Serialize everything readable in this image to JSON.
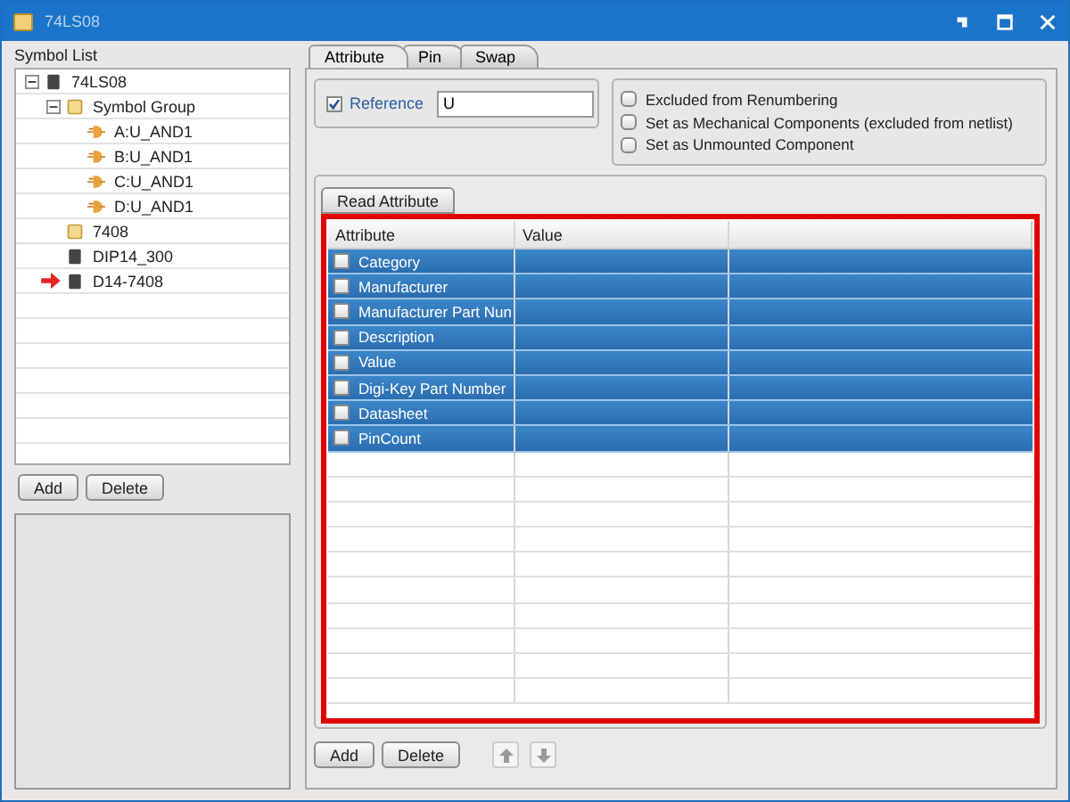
{
  "window": {
    "title": "74LS08"
  },
  "symbol_list": {
    "label": "Symbol List",
    "items": [
      {
        "label": "74LS08",
        "kind": "chip",
        "expanded": true,
        "current": false,
        "children": [
          {
            "label": "Symbol Group",
            "kind": "folder",
            "expanded": true,
            "current": false,
            "children": [
              {
                "label": "A:U_AND1",
                "kind": "gate",
                "current": false
              },
              {
                "label": "B:U_AND1",
                "kind": "gate",
                "current": false
              },
              {
                "label": "C:U_AND1",
                "kind": "gate",
                "current": false
              },
              {
                "label": "D:U_AND1",
                "kind": "gate",
                "current": false
              }
            ]
          },
          {
            "label": "7408",
            "kind": "folder",
            "current": false
          },
          {
            "label": "DIP14_300",
            "kind": "chip",
            "current": false
          },
          {
            "label": "D14-7408",
            "kind": "chip",
            "current": true
          }
        ]
      }
    ],
    "buttons": [
      "Add",
      "Delete"
    ]
  },
  "tabs": [
    {
      "label": "Attribute",
      "selected": true
    },
    {
      "label": "Pin",
      "selected": false
    },
    {
      "label": "Swap",
      "selected": false
    }
  ],
  "reference": {
    "label": "Reference",
    "checked": true,
    "value": "U"
  },
  "options": [
    {
      "label": "Excluded from Renumbering",
      "checked": false
    },
    {
      "label": "Set as Mechanical Components (excluded from netlist)",
      "checked": false
    },
    {
      "label": "Set as Unmounted Component",
      "checked": false
    }
  ],
  "read_attribute_button": "Read Attribute",
  "table": {
    "columns": [
      "Attribute",
      "Value"
    ],
    "rows": [
      {
        "attribute": "Category",
        "checked": false,
        "selected": true
      },
      {
        "attribute": "Manufacturer",
        "checked": false,
        "selected": true
      },
      {
        "attribute": "Manufacturer Part Nun",
        "checked": false,
        "selected": true
      },
      {
        "attribute": "Description",
        "checked": false,
        "selected": true
      },
      {
        "attribute": "Value",
        "checked": false,
        "selected": true
      },
      {
        "attribute": "Digi-Key Part Number",
        "checked": false,
        "selected": true
      },
      {
        "attribute": "Datasheet",
        "checked": false,
        "selected": true
      },
      {
        "attribute": "PinCount",
        "checked": false,
        "selected": true
      }
    ]
  },
  "bottom_buttons": [
    "Add",
    "Delete"
  ]
}
